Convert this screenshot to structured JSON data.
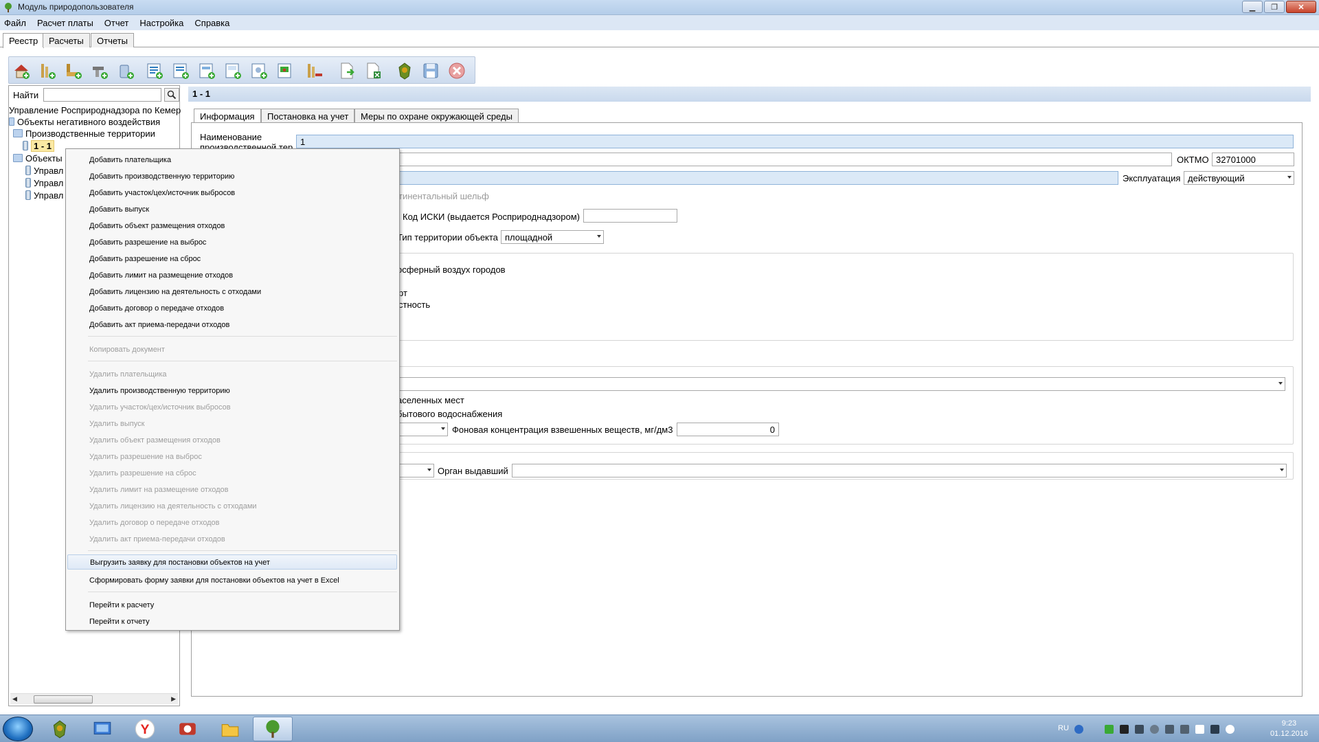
{
  "window": {
    "title": "Модуль природопользователя"
  },
  "menu": [
    "Файл",
    "Расчет платы",
    "Отчет",
    "Настройка",
    "Справка"
  ],
  "main_tabs": [
    "Реестр",
    "Расчеты",
    "Отчеты"
  ],
  "search": {
    "label": "Найти",
    "value": ""
  },
  "tree": {
    "root": "Управление Росприроднадзора по Кемер",
    "n1": "Объекты негативного воздействия",
    "n2": "Производственные территории",
    "selected": "1 - 1",
    "n3": "Объекты",
    "c1": "Управл",
    "c2": "Управл",
    "c3": "Управл"
  },
  "detail": {
    "header": "1 - 1",
    "subtabs": [
      "Информация",
      "Постановка на учет",
      "Меры по охране окружающей среды"
    ],
    "name_label_1": "Наименование",
    "name_label_2": "производственной тер",
    "name_value": "1",
    "oktmo_label": "ОКТМО",
    "oktmo_value": "32701000",
    "exploitation_label": "Эксплуатация",
    "exploitation_value": "действующий",
    "shelf_text": "тинентальный шельф",
    "iski_label": "Код ИСКИ (выдается Росприроднадзором)",
    "iski_value": "",
    "territory_type_label": "Тип территории объекта",
    "territory_type_value": "площадной",
    "air_text": "осферный воздух городов",
    "transport_text": "рт",
    "area_text": "стность",
    "places_text": "аселенных мест",
    "water_text": "бытового водоснабжения",
    "bg_conc_label": "Фоновая концентрация взвешенных веществ, мг/дм3",
    "bg_conc_value": "0",
    "issuer_label": "Орган выдавший",
    "issuer_value": ""
  },
  "context_menu": {
    "add_items": [
      "Добавить плательщика",
      "Добавить производственную территорию",
      "Добавить участок/цех/источник выбросов",
      "Добавить выпуск",
      "Добавить объект размещения отходов",
      "Добавить разрешение на выброс",
      "Добавить разрешение на сброс",
      "Добавить лимит на размещение отходов",
      "Добавить лицензию на деятельность с отходами",
      "Добавить договор о передаче отходов",
      "Добавить акт приема-передачи отходов"
    ],
    "copy": "Копировать документ",
    "delete_items": [
      "Удалить плательщика",
      "Удалить производственную территорию",
      "Удалить участок/цех/источник выбросов",
      "Удалить выпуск",
      "Удалить объект размещения отходов",
      "Удалить разрешение на выброс",
      "Удалить разрешение на сброс",
      "Удалить лимит на размещение отходов",
      "Удалить лицензию на деятельность с отходами",
      "Удалить договор о передаче отходов",
      "Удалить акт приема-передачи отходов"
    ],
    "export_items": [
      "Выгрузить заявку для постановки объектов на учет",
      "Сформировать форму заявки для постановки объектов на учет в Excel"
    ],
    "nav_items": [
      "Перейти к расчету",
      "Перейти к отчету"
    ]
  },
  "taskbar": {
    "lang": "RU",
    "time": "9:23",
    "date": "01.12.2016"
  },
  "colors": {
    "accent": "#dbe9f7",
    "selection": "#fbe9a4",
    "taskbar": "#8fb0d3"
  }
}
